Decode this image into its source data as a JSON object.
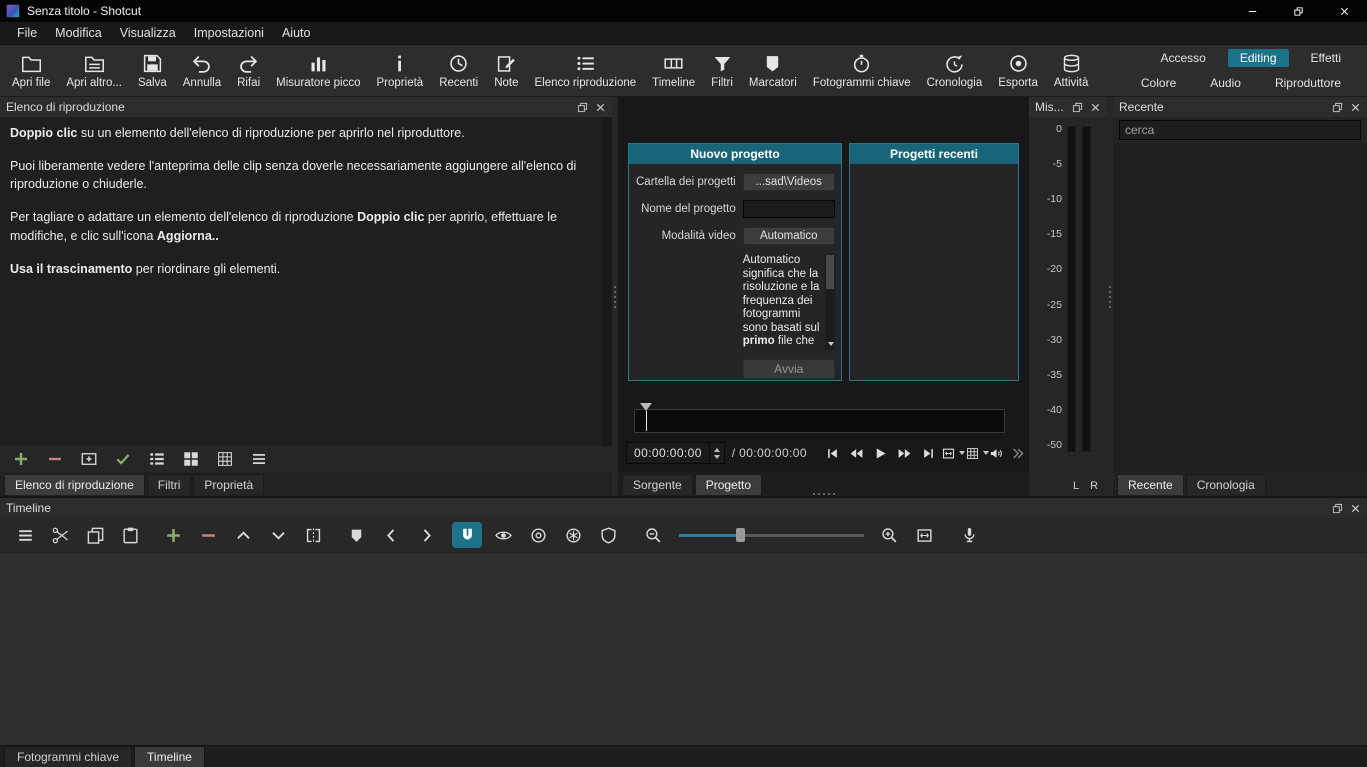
{
  "window": {
    "title": "Senza titolo - Shotcut"
  },
  "menubar": {
    "items": [
      "File",
      "Modifica",
      "Visualizza",
      "Impostazioni",
      "Aiuto"
    ]
  },
  "toolbar": {
    "buttons": [
      "Apri file",
      "Apri altro...",
      "Salva",
      "Annulla",
      "Rifai",
      "Misuratore picco",
      "Proprietà",
      "Recenti",
      "Note",
      "Elenco riproduzione",
      "Timeline",
      "Filtri",
      "Marcatori",
      "Fotogrammi chiave",
      "Cronologia",
      "Esporta",
      "Attività"
    ],
    "workspace_row1": [
      "Accesso",
      "Editing",
      "Effetti"
    ],
    "workspace_row2": [
      "Colore",
      "Audio",
      "Riproduttore"
    ]
  },
  "playlist": {
    "title": "Elenco di riproduzione",
    "p1_bold": "Doppio clic",
    "p1_rest": " su un elemento dell'elenco di riproduzione per aprirlo nel riproduttore.",
    "p2": "Puoi liberamente vedere l'anteprima delle clip senza doverle necessariamente aggiungere all'elenco di riproduzione o chiuderle.",
    "p3_a": "Per tagliare o adattare un elemento dell'elenco di riproduzione ",
    "p3_bold1": "Doppio clic",
    "p3_b": " per aprirlo, effettuare le modifiche, e clic sull'icona ",
    "p3_bold2": "Aggiorna..",
    "p4_bold": "Usa il trascinamento",
    "p4_rest": " per riordinare gli elementi.",
    "tabs": [
      "Elenco di riproduzione",
      "Filtri",
      "Proprietà"
    ]
  },
  "new_project": {
    "title": "Nuovo progetto",
    "folder_label": "Cartella dei progetti",
    "folder_button": "...sad\\Videos",
    "name_label": "Nome del progetto",
    "video_mode_label": "Modalità video",
    "video_mode_button": "Automatico",
    "desc_pre": "Automatico significa che la risoluzione e la frequenza dei fotogrammi sono basati sul ",
    "desc_bold": "primo",
    "desc_post": " file che",
    "start_button": "Avvia"
  },
  "recent_projects": {
    "title": "Progetti recenti"
  },
  "player": {
    "position": "00:00:00:00",
    "separator": "/",
    "duration": "00:00:00:00",
    "tabs": [
      "Sorgente",
      "Progetto"
    ]
  },
  "peak_meter": {
    "title": "Mis...",
    "scale": [
      "0",
      "-5",
      "-10",
      "-15",
      "-20",
      "-25",
      "-30",
      "-35",
      "-40",
      "-50"
    ],
    "channel_left": "L",
    "channel_right": "R"
  },
  "recent": {
    "title": "Recente",
    "search_placeholder": "cerca",
    "tabs": [
      "Recente",
      "Cronologia"
    ]
  },
  "timeline": {
    "title": "Timeline"
  },
  "bottom_tabs": [
    "Fotogrammi chiave",
    "Timeline"
  ],
  "colors": {
    "accent_teal": "#1b7389",
    "box_header_teal": "#18657a",
    "append_green": "#8aae6a",
    "delete_red": "#c98080"
  }
}
